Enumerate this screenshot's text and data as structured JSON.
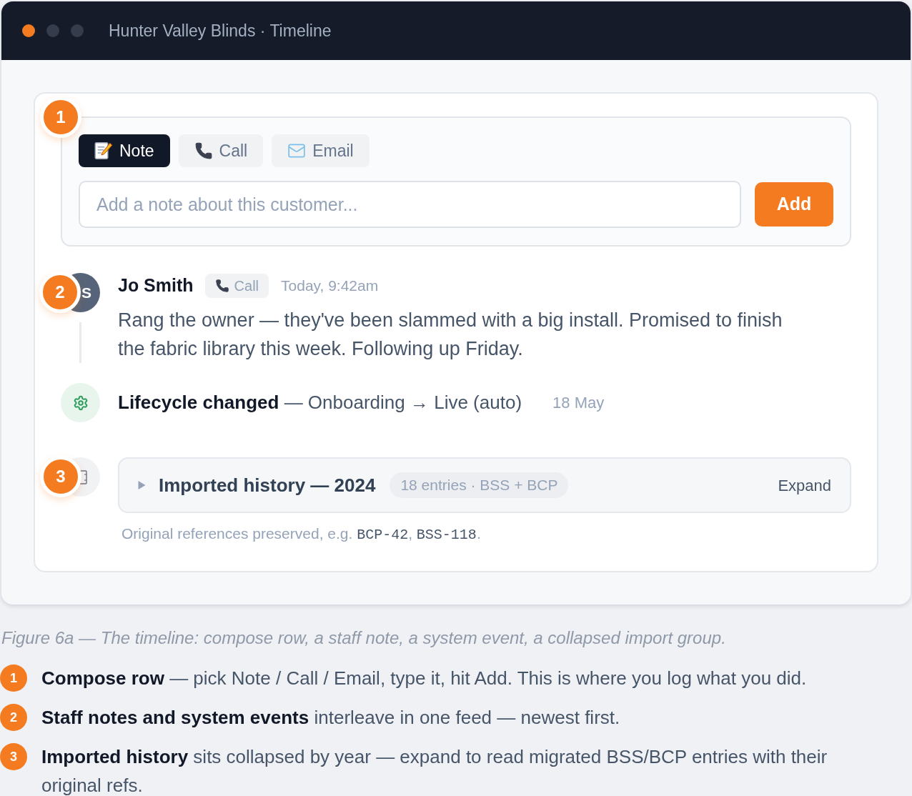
{
  "window": {
    "title": "Hunter Valley Blinds · Timeline"
  },
  "composer": {
    "badge": "1",
    "tabs": [
      {
        "label": "Note",
        "kind": "note",
        "selected": true
      },
      {
        "label": "Call",
        "kind": "call",
        "selected": false
      },
      {
        "label": "Email",
        "kind": "email",
        "selected": false
      }
    ],
    "input": {
      "placeholder": "Add a note about this customer..."
    },
    "submit": "Add"
  },
  "timeline": [
    {
      "kind": "note",
      "badge": "2",
      "avatar": "S",
      "author": "Jo Smith",
      "channel": {
        "kind": "call",
        "label": "Call"
      },
      "time": "Today, 9:42am",
      "body": "Rang the owner — they've been slammed with a big install. Promised to finish the fabric library this week. Following up Friday."
    },
    {
      "kind": "event",
      "text": "**Lifecycle changed** — Onboarding → Live (auto)",
      "date": "18 May"
    },
    {
      "kind": "import_group",
      "badge": "3",
      "title": "Imported history — 2024",
      "chip": "18 entries · BSS + BCP",
      "expanded": false,
      "action": "Expand",
      "footnote": [
        {
          "kind": "text",
          "text": "Original references preserved, e.g. "
        },
        {
          "kind": "code",
          "text": "BCP-42"
        },
        {
          "kind": "text",
          "text": ", "
        },
        {
          "kind": "code",
          "text": "BSS-118"
        },
        {
          "kind": "text",
          "text": "."
        }
      ]
    }
  ],
  "caption": "Figure 6a — The timeline: compose row, a staff note, a system event, a collapsed import group.",
  "legend": [
    {
      "badge": "1",
      "text": "**Compose row** — pick Note / Call / Email, type it, hit Add. This is where you log what you did."
    },
    {
      "badge": "2",
      "text": "**Staff notes and system events** interleave in one feed — newest first."
    },
    {
      "badge": "3",
      "text": "**Imported history** sits collapsed by year — expand to read migrated BSS/BCP entries with their original refs."
    }
  ]
}
